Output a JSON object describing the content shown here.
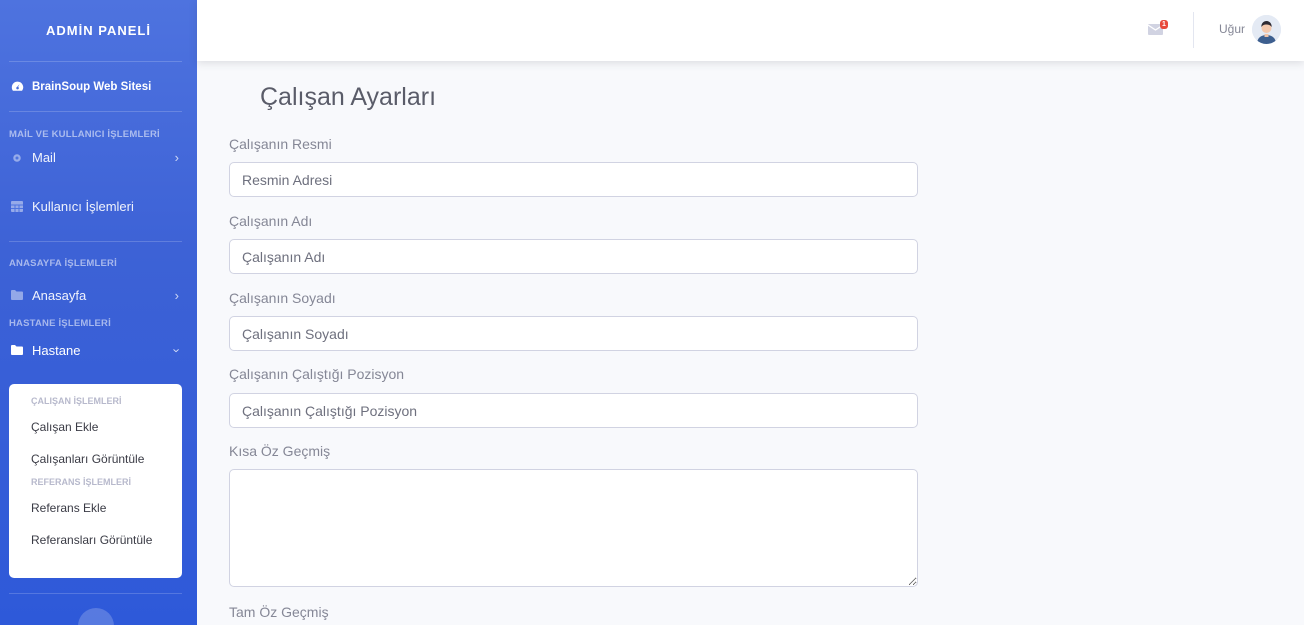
{
  "sidebar": {
    "brand": "ADMİN PANELİ",
    "dashboard": "BrainSoup Web Sitesi",
    "heading_mail": "MAİL VE KULLANICI İŞLEMLERİ",
    "mail": "Mail",
    "users": "Kullanıcı İşlemleri",
    "heading_home": "ANASAYFA İŞLEMLERİ",
    "home": "Anasayfa",
    "heading_hospital": "HASTANE İŞLEMLERİ",
    "hospital": "Hastane",
    "submenu": {
      "head_staff": "ÇALIŞAN İŞLEMLERİ",
      "add_staff": "Çalışan Ekle",
      "view_staff": "Çalışanları Görüntüle",
      "head_ref": "REFERANS İŞLEMLERİ",
      "add_ref": "Referans Ekle",
      "view_ref": "Referansları Görüntüle"
    }
  },
  "topbar": {
    "mail_badge": "1",
    "user_name": "Uğur"
  },
  "main": {
    "title": "Çalışan Ayarları",
    "fields": {
      "photo_label": "Çalışanın Resmi",
      "photo_placeholder": "Resmin Adresi",
      "name_label": "Çalışanın Adı",
      "name_placeholder": "Çalışanın Adı",
      "surname_label": "Çalışanın Soyadı",
      "surname_placeholder": "Çalışanın Soyadı",
      "position_label": "Çalışanın Çalıştığı Pozisyon",
      "position_placeholder": "Çalışanın Çalıştığı Pozisyon",
      "short_bio_label": "Kısa Öz Geçmiş",
      "full_bio_label": "Tam Öz Geçmiş"
    }
  },
  "colors": {
    "sidebar": "#4e73df",
    "badge": "#e74a3b"
  }
}
